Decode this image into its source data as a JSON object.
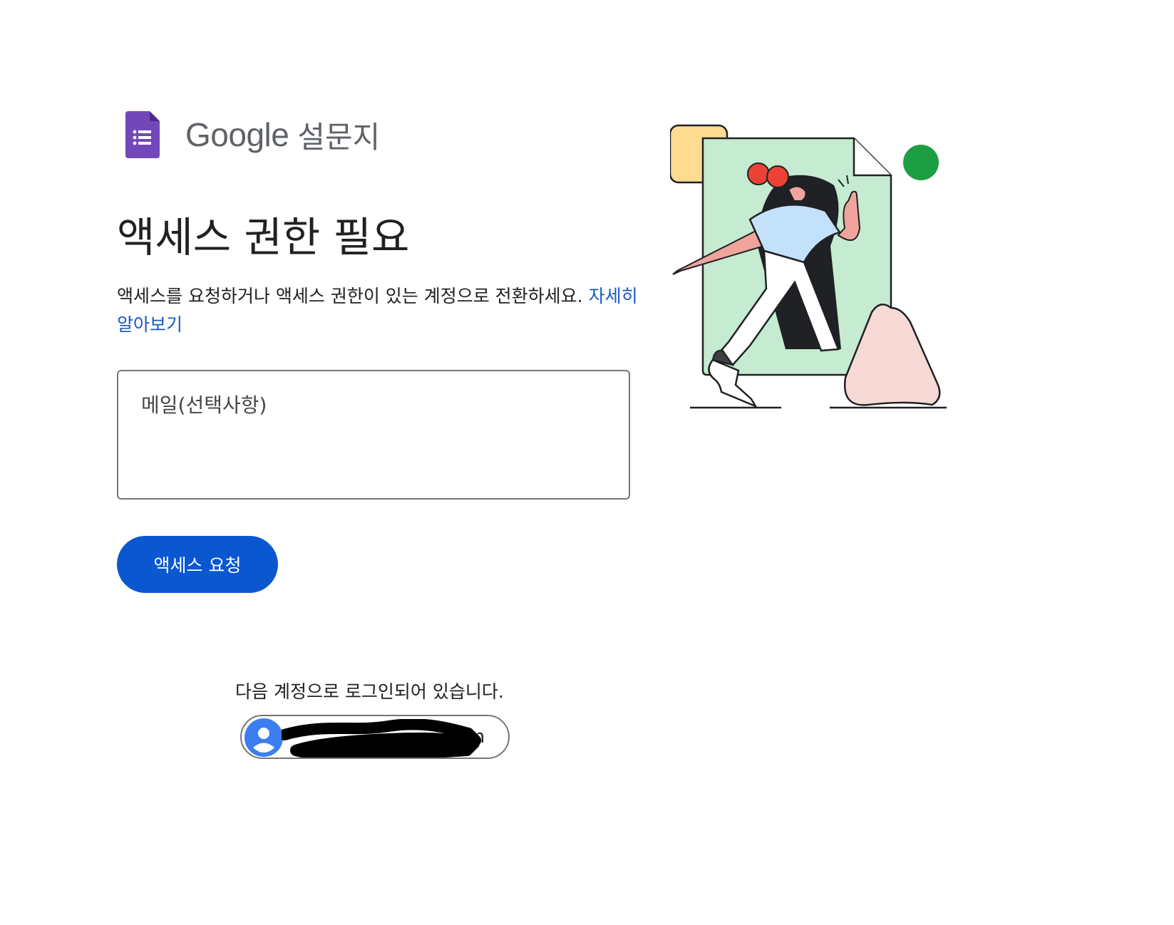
{
  "brand": {
    "logo_icon": "google-forms-icon",
    "name": "Google",
    "product": "설문지",
    "logo_color": "#7248b9"
  },
  "heading": "액세스 권한 필요",
  "description": {
    "text": "액세스를 요청하거나 액세스 권한이 있는 계정으로 전환하세요.",
    "link_label": "자세히 알아보기"
  },
  "email_field": {
    "value": "",
    "placeholder": "메일(선택사항)"
  },
  "request_button": {
    "label": "액세스 요청",
    "color": "#0b57d0"
  },
  "account": {
    "signed_in_text": "다음 계정으로 로그인되어 있습니다.",
    "avatar_icon": "account-circle-icon",
    "email_visible_suffix": "om",
    "redacted": true
  },
  "link_color": "#1a57c9"
}
